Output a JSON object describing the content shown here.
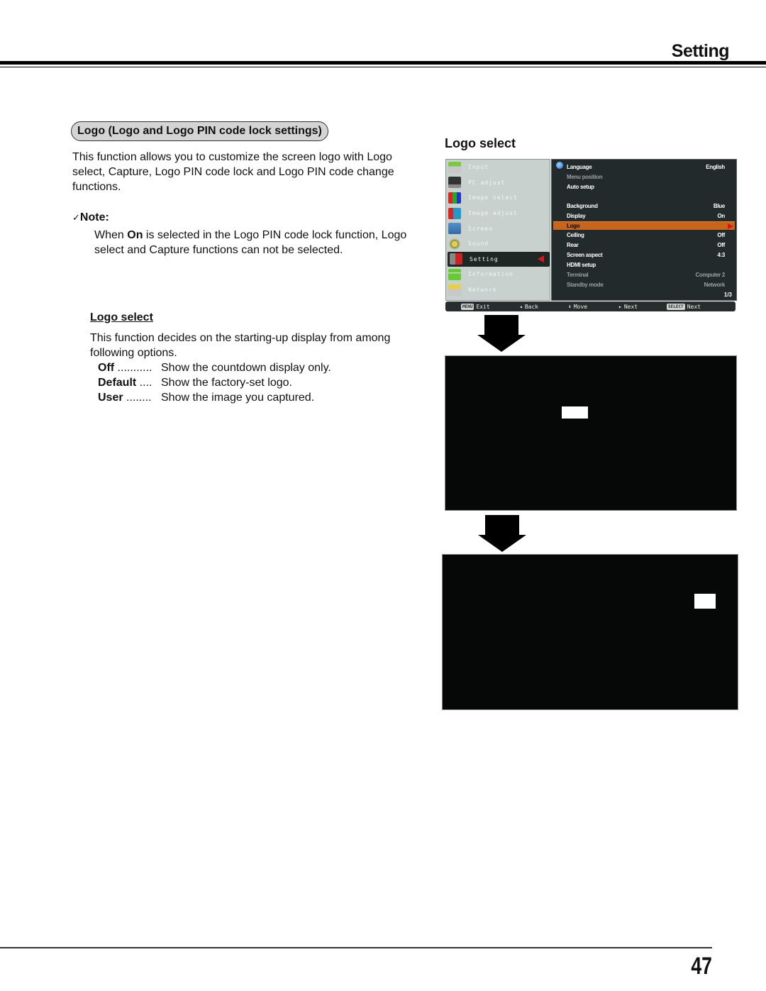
{
  "header": {
    "section_title": "Setting"
  },
  "left": {
    "section_pill": "Logo (Logo and Logo PIN code lock settings)",
    "intro": "This function allows you to customize the screen logo with Logo select, Capture, Logo PIN code lock and Logo PIN code change functions.",
    "note": {
      "check_icon": "checkmark-icon",
      "heading": "Note:",
      "body_pre": "When ",
      "body_bold": "On",
      "body_post": " is selected in the Logo PIN code lock function, Logo select and Capture functions can not be selected."
    },
    "logo_select": {
      "heading": "Logo select",
      "body": "This function decides on the starting-up display from among following options.",
      "options": [
        {
          "name": "Off",
          "dots": " ...........",
          "desc": "Show the countdown display only."
        },
        {
          "name": "Default",
          "dots": " ....",
          "desc": "Show the factory-set logo."
        },
        {
          "name": "User",
          "dots": " ........",
          "desc": "Show the image you captured."
        }
      ]
    }
  },
  "right": {
    "title": "Logo select",
    "osd": {
      "main_menu": [
        {
          "label": "Input",
          "icon": "input-icon"
        },
        {
          "label": "PC adjust",
          "icon": "pc-adjust-icon"
        },
        {
          "label": "Image select",
          "icon": "image-select-icon"
        },
        {
          "label": "Image adjust",
          "icon": "image-adjust-icon"
        },
        {
          "label": "Screen",
          "icon": "screen-icon"
        },
        {
          "label": "Sound",
          "icon": "sound-icon"
        },
        {
          "label": "Setting",
          "icon": "setting-icon",
          "active": true
        },
        {
          "label": "Information",
          "icon": "information-icon"
        },
        {
          "label": "Network",
          "icon": "network-icon"
        }
      ],
      "sub_menu": [
        {
          "label": "Language",
          "value": "English"
        },
        {
          "label": "Menu position",
          "value": ""
        },
        {
          "label": "Auto setup",
          "value": ""
        },
        {
          "label": "Background",
          "value": "Blue"
        },
        {
          "label": "Display",
          "value": "On"
        },
        {
          "label": "Logo",
          "value": "",
          "selected": true
        },
        {
          "label": "Ceiling",
          "value": "Off"
        },
        {
          "label": "Rear",
          "value": "Off"
        },
        {
          "label": "Screen aspect",
          "value": "4:3"
        },
        {
          "label": "HDMI setup",
          "value": ""
        },
        {
          "label": "Terminal",
          "value": "Computer 2"
        },
        {
          "label": "Standby mode",
          "value": "Network"
        }
      ],
      "page_indicator": "1/3",
      "hints": {
        "exit_key": "MENU",
        "exit": "Exit",
        "back": "Back",
        "move": "Move",
        "next": "Next",
        "select_key": "SELECT",
        "select_next": "Next"
      }
    },
    "colors": {
      "selected_row": "#c9651a",
      "active_arrow": "#e0121a",
      "menu_bg": "#c9d1ce",
      "submenu_bg": "#232a2b"
    }
  },
  "footer": {
    "page_number": "47"
  }
}
